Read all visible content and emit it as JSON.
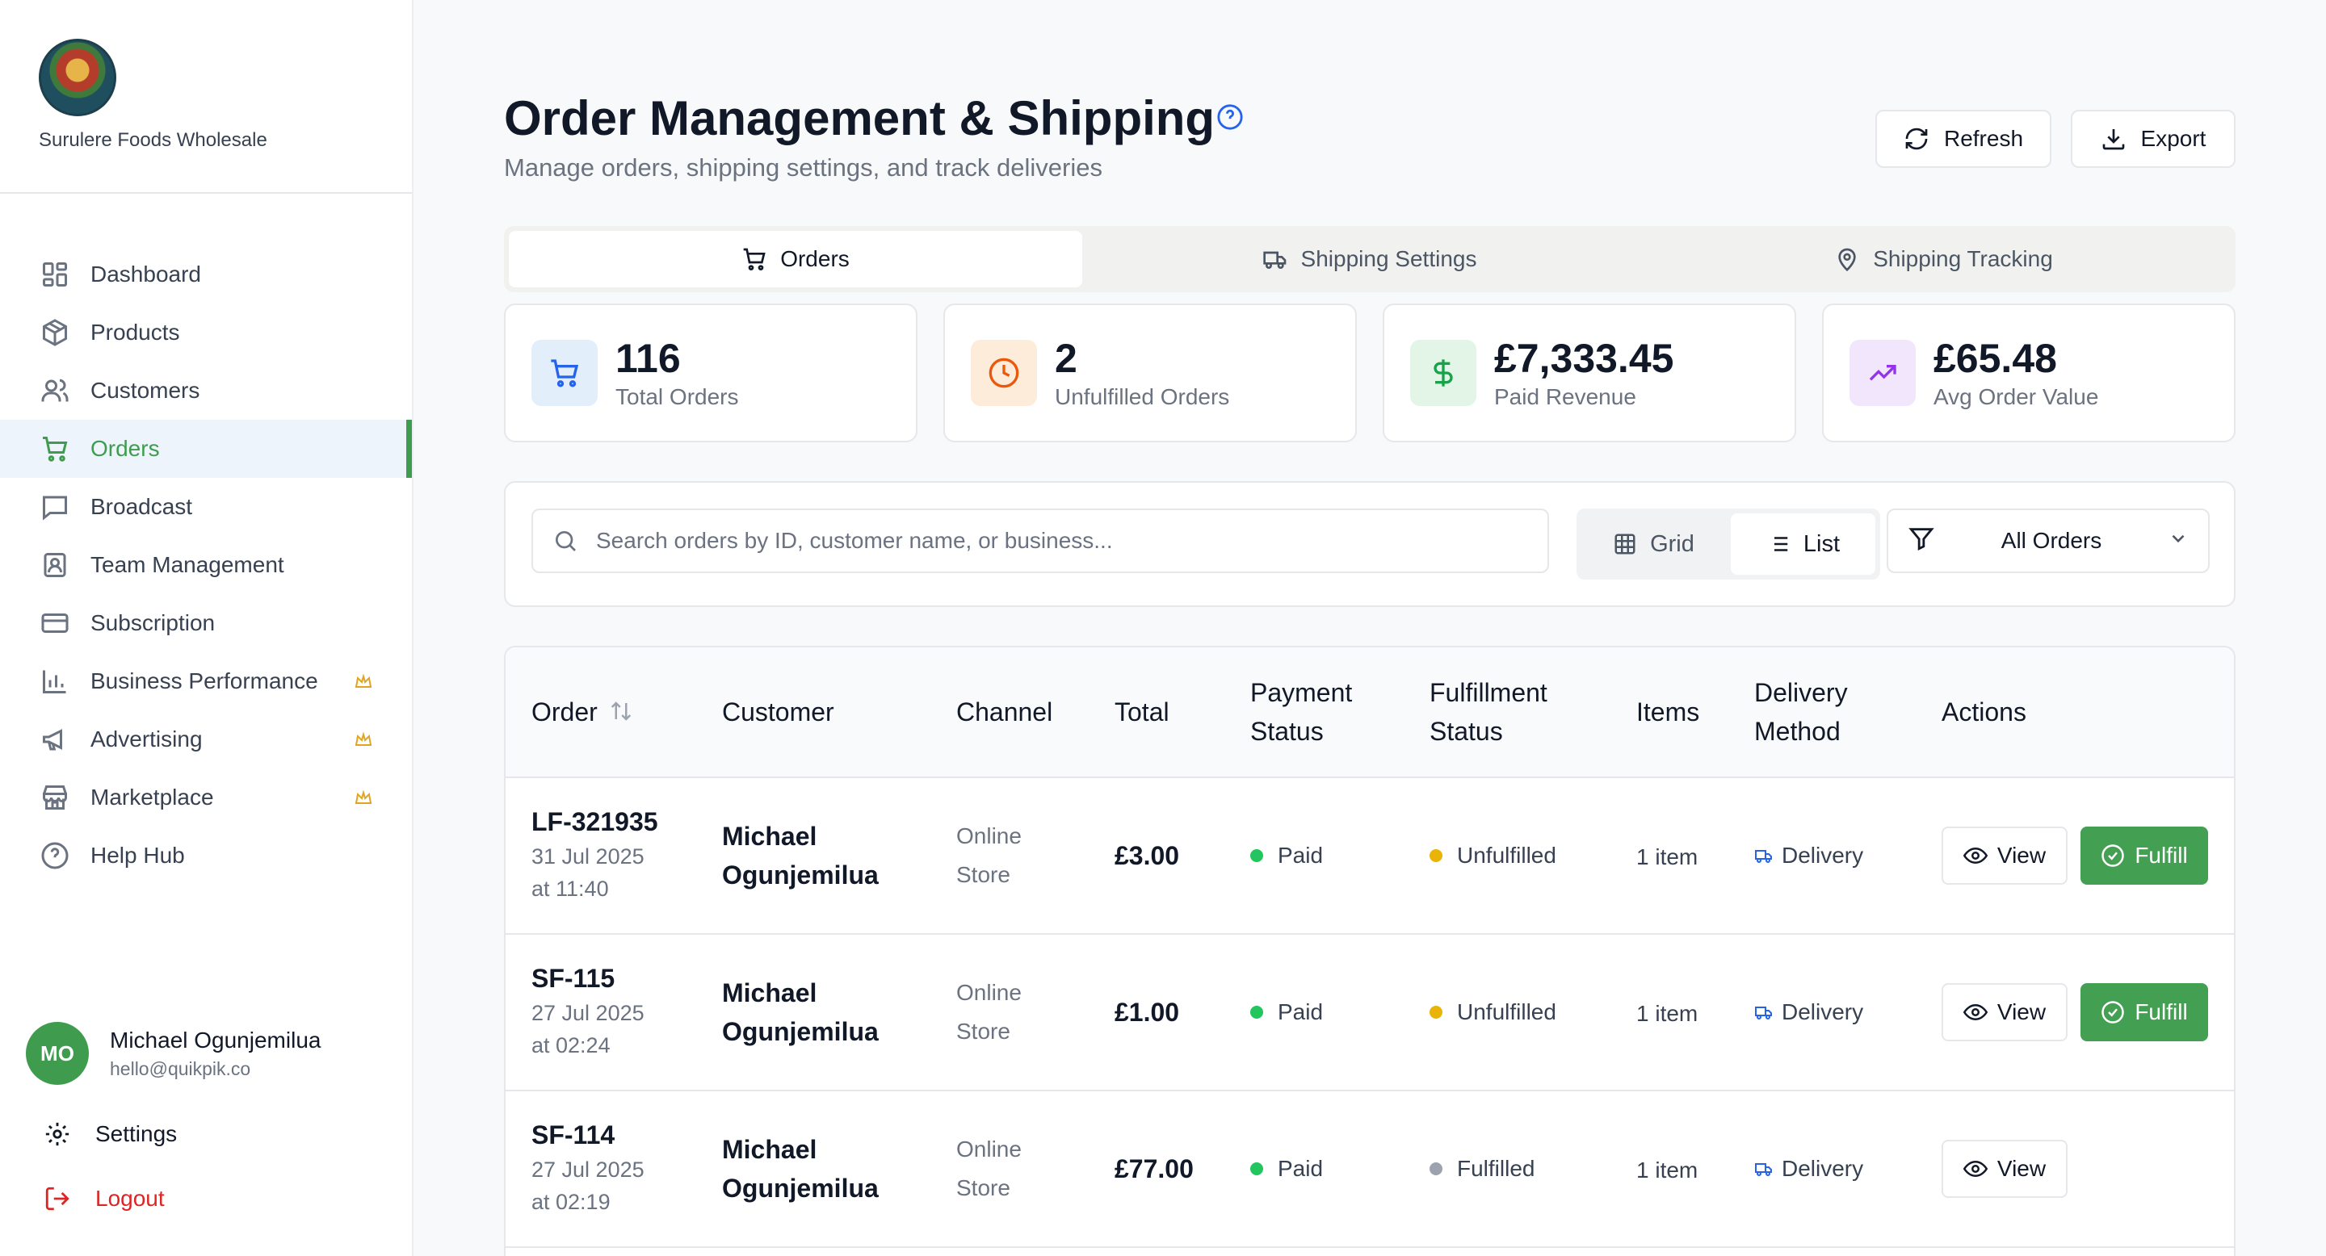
{
  "brand": {
    "name": "Surulere Foods Wholesale"
  },
  "nav": [
    {
      "label": "Dashboard",
      "icon": "dashboard-icon",
      "active": false,
      "premium": false
    },
    {
      "label": "Products",
      "icon": "package-icon",
      "active": false,
      "premium": false
    },
    {
      "label": "Customers",
      "icon": "users-icon",
      "active": false,
      "premium": false
    },
    {
      "label": "Orders",
      "icon": "cart-icon",
      "active": true,
      "premium": false
    },
    {
      "label": "Broadcast",
      "icon": "message-icon",
      "active": false,
      "premium": false
    },
    {
      "label": "Team Management",
      "icon": "team-icon",
      "active": false,
      "premium": false
    },
    {
      "label": "Subscription",
      "icon": "credit-card-icon",
      "active": false,
      "premium": false
    },
    {
      "label": "Business Performance",
      "icon": "bar-chart-icon",
      "active": false,
      "premium": true
    },
    {
      "label": "Advertising",
      "icon": "megaphone-icon",
      "active": false,
      "premium": true
    },
    {
      "label": "Marketplace",
      "icon": "store-icon",
      "active": false,
      "premium": true
    },
    {
      "label": "Help Hub",
      "icon": "help-circle-icon",
      "active": false,
      "premium": false
    }
  ],
  "user": {
    "initials": "MO",
    "name": "Michael Ogunjemilua",
    "email": "hello@quikpik.co"
  },
  "settings_label": "Settings",
  "logout_label": "Logout",
  "header": {
    "title": "Order Management & Shipping",
    "subtitle": "Manage orders, shipping settings, and track deliveries",
    "refresh_label": "Refresh",
    "export_label": "Export"
  },
  "tabs": [
    {
      "label": "Orders",
      "icon": "cart-icon",
      "active": true
    },
    {
      "label": "Shipping Settings",
      "icon": "truck-icon",
      "active": false
    },
    {
      "label": "Shipping Tracking",
      "icon": "map-pin-icon",
      "active": false
    }
  ],
  "stats": [
    {
      "value": "116",
      "label": "Total Orders",
      "icon": "cart-icon",
      "bg": "#e3eefb",
      "color": "#2563eb"
    },
    {
      "value": "2",
      "label": "Unfulfilled Orders",
      "icon": "clock-icon",
      "bg": "#fdecd9",
      "color": "#ea580c"
    },
    {
      "value": "£7,333.45",
      "label": "Paid Revenue",
      "icon": "dollar-icon",
      "bg": "#e2f5e6",
      "color": "#16a34a"
    },
    {
      "value": "£65.48",
      "label": "Avg Order Value",
      "icon": "trending-up-icon",
      "bg": "#f1e6fb",
      "color": "#9333ea"
    }
  ],
  "toolbar": {
    "search_placeholder": "Search orders by ID, customer name, or business...",
    "search_value": "",
    "grid_label": "Grid",
    "list_label": "List",
    "filter_value": "All Orders"
  },
  "table": {
    "columns": {
      "order": "Order",
      "customer": "Customer",
      "channel": "Channel",
      "total": "Total",
      "payment_1": "Payment",
      "payment_2": "Status",
      "fulfillment_1": "Fulfillment",
      "fulfillment_2": "Status",
      "items": "Items",
      "delivery_1": "Delivery",
      "delivery_2": "Method",
      "actions": "Actions"
    },
    "rows": [
      {
        "id": "LF-321935",
        "date_1": "31 Jul 2025",
        "date_2": "at 11:40",
        "customer_1": "Michael",
        "customer_2": "Ogunjemilua",
        "channel_1": "Online",
        "channel_2": "Store",
        "total": "£3.00",
        "payment": "Paid",
        "payment_color": "#22c55e",
        "fulfillment": "Unfulfilled",
        "fulfillment_color": "#eab308",
        "items": "1 item",
        "delivery": "Delivery",
        "view_label": "View",
        "fulfill_label": "Fulfill",
        "can_fulfill": true
      },
      {
        "id": "SF-115",
        "date_1": "27 Jul 2025",
        "date_2": "at 02:24",
        "customer_1": "Michael",
        "customer_2": "Ogunjemilua",
        "channel_1": "Online",
        "channel_2": "Store",
        "total": "£1.00",
        "payment": "Paid",
        "payment_color": "#22c55e",
        "fulfillment": "Unfulfilled",
        "fulfillment_color": "#eab308",
        "items": "1 item",
        "delivery": "Delivery",
        "view_label": "View",
        "fulfill_label": "Fulfill",
        "can_fulfill": true
      },
      {
        "id": "SF-114",
        "date_1": "27 Jul 2025",
        "date_2": "at 02:19",
        "customer_1": "Michael",
        "customer_2": "Ogunjemilua",
        "channel_1": "Online",
        "channel_2": "Store",
        "total": "£77.00",
        "payment": "Paid",
        "payment_color": "#22c55e",
        "fulfillment": "Fulfilled",
        "fulfillment_color": "#9ca3af",
        "items": "1 item",
        "delivery": "Delivery",
        "view_label": "View",
        "fulfill_label": "",
        "can_fulfill": false
      }
    ]
  }
}
